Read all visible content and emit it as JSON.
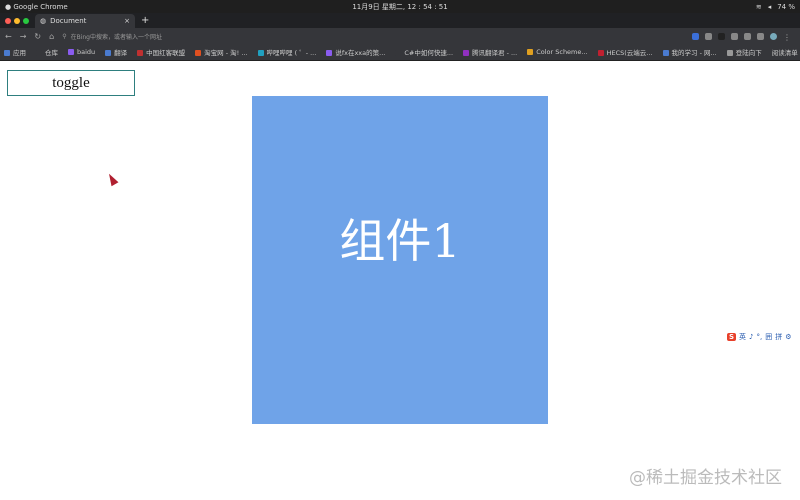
{
  "os": {
    "app": "Google Chrome",
    "clock": "11月9日 星期二, 12 : 54 : 51",
    "battery": "74 %"
  },
  "browser": {
    "tab_title": "Document",
    "tab_close": "×",
    "new_tab": "+",
    "omnibox_placeholder": "在Bing中搜索，或者输入一个网址",
    "bookmarks": [
      {
        "label": "应用",
        "color": "#4a7bd0"
      },
      {
        "label": "仓库",
        "color": "#35363a"
      },
      {
        "label": "baidu",
        "color": "#8a5cf0"
      },
      {
        "label": "翻译",
        "color": "#4a7bd0"
      },
      {
        "label": "中国红客联盟",
        "color": "#c03030"
      },
      {
        "label": "淘宝网 - 淘! ...",
        "color": "#e05020"
      },
      {
        "label": "哔哩哔哩 ( ゜- ...",
        "color": "#20a0c0"
      },
      {
        "label": "说fx在xxa的策...",
        "color": "#8a5cf0"
      },
      {
        "label": "C#中如何快速...",
        "color": "#35363a"
      },
      {
        "label": "腾讯翻译君 - ...",
        "color": "#9030c0"
      },
      {
        "label": "Color Scheme...",
        "color": "#e0a020"
      },
      {
        "label": "HECS(云端云...",
        "color": "#c02030"
      },
      {
        "label": "我的学习 - 网...",
        "color": "#4a7bd0"
      },
      {
        "label": "登陆向下",
        "color": "#999999"
      }
    ],
    "reading_list": "阅读清单"
  },
  "page": {
    "toggle_label": "toggle",
    "component_text": "组件1",
    "component_color": "#6fa3e8"
  },
  "ime": {
    "logo": "S",
    "items": [
      "英",
      "♪",
      "°,",
      "囲",
      "拼",
      "⚙"
    ]
  },
  "watermark": "@稀土掘金技术社区"
}
